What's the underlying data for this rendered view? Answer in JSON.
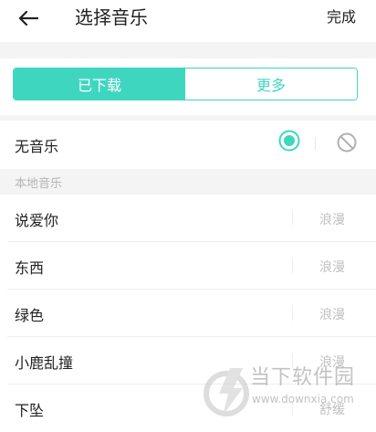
{
  "header": {
    "title": "选择音乐",
    "done_label": "完成"
  },
  "tabs": [
    {
      "label": "已下载",
      "active": true
    },
    {
      "label": "更多",
      "active": false
    }
  ],
  "no_music": {
    "label": "无音乐",
    "selected": true
  },
  "section": {
    "title": "本地音乐"
  },
  "songs": [
    {
      "title": "说爱你",
      "style": "浪漫"
    },
    {
      "title": "东西",
      "style": "浪漫"
    },
    {
      "title": "绿色",
      "style": "浪漫"
    },
    {
      "title": "小鹿乱撞",
      "style": "浪漫"
    },
    {
      "title": "下坠",
      "style": "舒缓"
    }
  ],
  "watermark": {
    "brand": "当下软件园",
    "url": "www.downxia.com"
  },
  "colors": {
    "accent": "#3fd6c0",
    "divider": "#eeeeee",
    "muted_text": "#c0c0c0",
    "section_bg": "#f4f4f4"
  }
}
